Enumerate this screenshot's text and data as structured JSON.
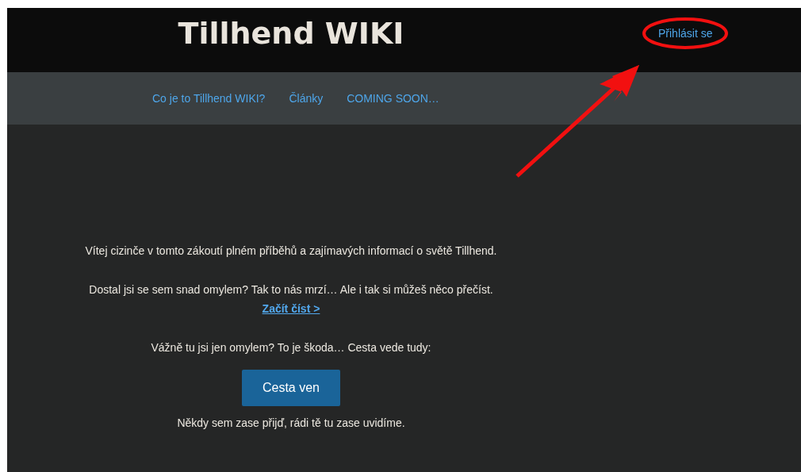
{
  "header": {
    "title": "Tillhend WIKI",
    "login_link": "Přihlásit se"
  },
  "nav": {
    "items": [
      {
        "label": "Co je to Tillhend WIKI?"
      },
      {
        "label": "Články"
      },
      {
        "label": "COMING SOON…"
      }
    ]
  },
  "content": {
    "welcome": "Vítej cizinče v tomto zákoutí plném příběhů a zajímavých informací  o světě Tillhend.",
    "mistake": "Dostal jsi se sem snad omylem? Tak to nás mrzí… Ale i tak si můžeš něco přečíst.",
    "read_link": "Začít číst >",
    "really": "Vážně tu jsi jen omylem? To je škoda… Cesta vede tudy:",
    "exit_button": "Cesta ven",
    "farewell": "Někdy sem zase přijď, rádi tě tu zase uvidíme."
  }
}
